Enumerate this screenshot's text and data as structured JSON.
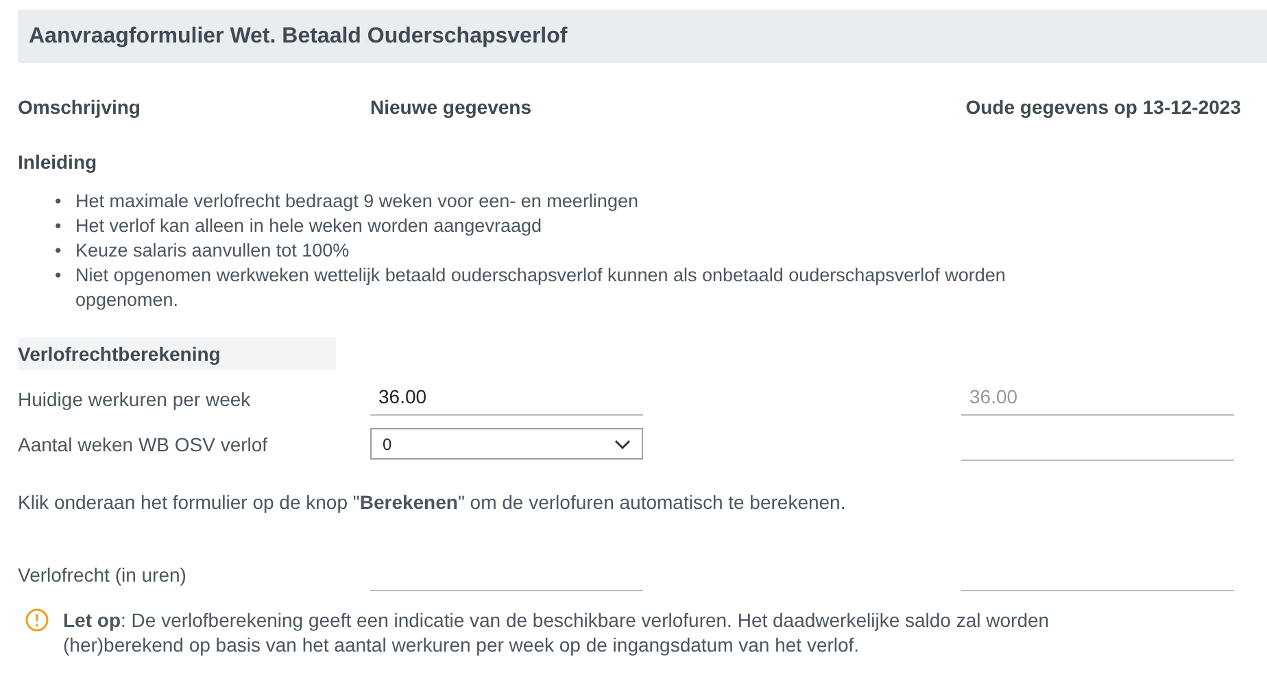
{
  "title": "Aanvraagformulier Wet. Betaald Ouderschapsverlof",
  "columns": [
    "Omschrijving",
    "Nieuwe gegevens",
    "Oude gegevens op 13-12-2023"
  ],
  "intro": {
    "heading": "Inleiding",
    "bullets": [
      {
        "marker": "•",
        "text": "Het maximale verlofrecht bedraagt 9 weken voor een- en meerlingen"
      },
      {
        "marker": "•",
        "text": "Het verlof kan alleen in hele weken worden aangevraagd"
      },
      {
        "marker": "•",
        "text": "Keuze salaris aanvullen tot 100%"
      },
      {
        "marker": "•",
        "text": "Niet opgenomen werkweken wettelijk betaald ouderschapsverlof kunnen als onbetaald ouderschapsverlof worden opgenomen."
      }
    ]
  },
  "section": "Verlofrechtberekening",
  "rows": [
    {
      "label": "Huidige werkuren per week",
      "kind": "input",
      "new_value": "36.00",
      "old_value": "36.00"
    },
    {
      "label": "Aantal weken WB OSV verlof",
      "kind": "select",
      "new_value": "0"
    }
  ],
  "instruction": "Klik onderaan het formulier op de knop \"**Berekenen**\" om de verlofuren automatisch te berekenen.",
  "result_rows": [
    {
      "label": "Verlofrecht (in uren)",
      "kind": "input"
    }
  ],
  "warning": "**Let op**: De verlofberekening geeft een indicatie van de beschikbare verlofuren. Het daadwerkelijke saldo zal worden (her)berekend op basis van het aantal werkuren per week op de ingangsdatum van het verlof."
}
